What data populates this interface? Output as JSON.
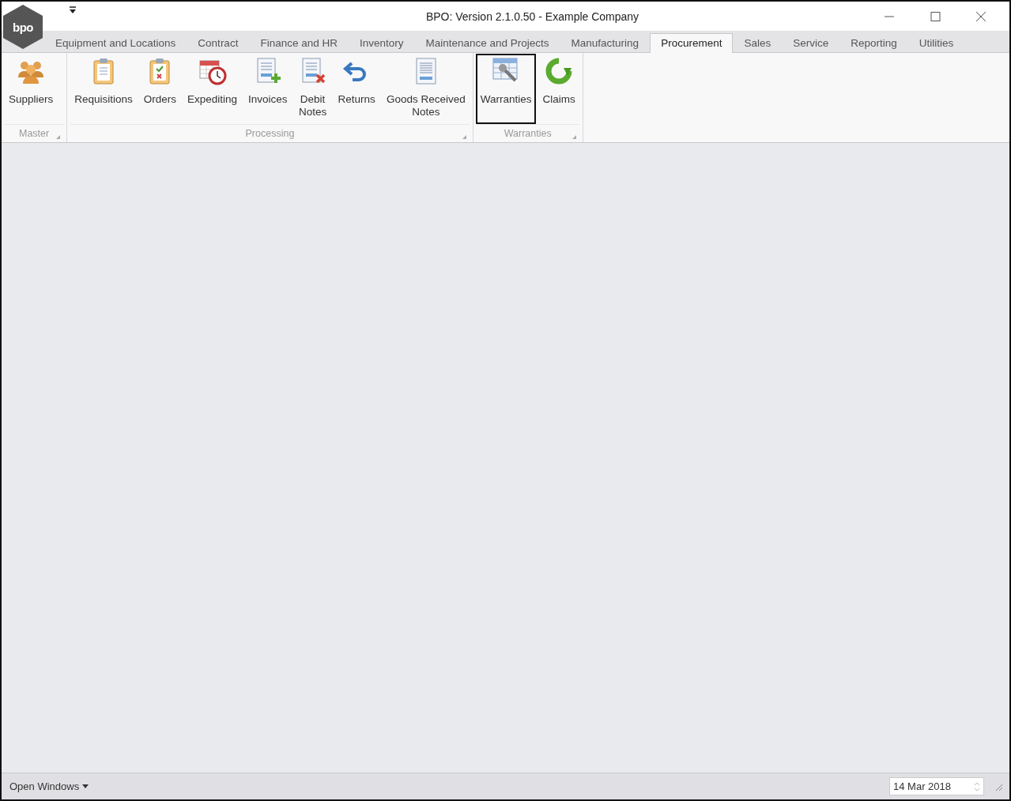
{
  "window": {
    "title": "BPO: Version 2.1.0.50 - Example Company",
    "logo_text": "bpo"
  },
  "tabs": [
    {
      "label": "Equipment and Locations",
      "selected": false
    },
    {
      "label": "Contract",
      "selected": false
    },
    {
      "label": "Finance and HR",
      "selected": false
    },
    {
      "label": "Inventory",
      "selected": false
    },
    {
      "label": "Maintenance and Projects",
      "selected": false
    },
    {
      "label": "Manufacturing",
      "selected": false
    },
    {
      "label": "Procurement",
      "selected": true
    },
    {
      "label": "Sales",
      "selected": false
    },
    {
      "label": "Service",
      "selected": false
    },
    {
      "label": "Reporting",
      "selected": false
    },
    {
      "label": "Utilities",
      "selected": false
    }
  ],
  "ribbon_groups": [
    {
      "label": "Master",
      "items": [
        {
          "label": "Suppliers",
          "kind": "people",
          "highlighted": false
        }
      ]
    },
    {
      "label": "Processing",
      "items": [
        {
          "label": "Requisitions",
          "kind": "clipboard",
          "highlighted": false
        },
        {
          "label": "Orders",
          "kind": "clipboard-check",
          "highlighted": false
        },
        {
          "label": "Expediting",
          "kind": "calendar-clock",
          "highlighted": false
        },
        {
          "label": "Invoices",
          "kind": "doc-plus",
          "highlighted": false
        },
        {
          "label": "Debit\nNotes",
          "kind": "doc-cross",
          "highlighted": false
        },
        {
          "label": "Returns",
          "kind": "return-arrow",
          "highlighted": false
        },
        {
          "label": "Goods Received\nNotes",
          "kind": "doc",
          "highlighted": false
        }
      ]
    },
    {
      "label": "Warranties",
      "items": [
        {
          "label": "Warranties",
          "kind": "table-wrench",
          "highlighted": true
        },
        {
          "label": "Claims",
          "kind": "refresh",
          "highlighted": false
        }
      ]
    }
  ],
  "status_bar": {
    "menu": "Open Windows",
    "date": "14 Mar 2018"
  }
}
